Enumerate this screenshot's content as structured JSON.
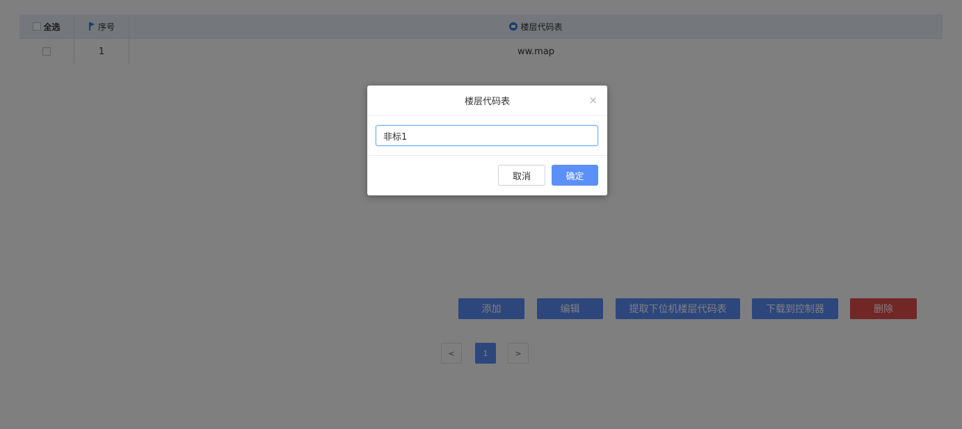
{
  "table": {
    "headers": {
      "select_all": "全选",
      "index": "序号",
      "floor_code_table": "楼层代码表"
    },
    "rows": [
      {
        "index": "1",
        "floor_code_table": "ww.map"
      }
    ]
  },
  "actions": {
    "add": "添加",
    "edit": "编辑",
    "fetch": "提取下位机楼层代码表",
    "download": "下载到控制器",
    "delete": "删除"
  },
  "pagination": {
    "prev": "<",
    "current": "1",
    "next": ">"
  },
  "dialog": {
    "title": "楼层代码表",
    "close": "×",
    "input_value": "非标1",
    "cancel": "取消",
    "confirm": "确定"
  },
  "icons": {
    "index_header": "flag-icon",
    "floor_code_header": "database-icon",
    "dialog_close": "close-icon"
  },
  "colors": {
    "primary": "#5b8ff9",
    "danger": "#e74c4c",
    "header_bg": "#e9eef6"
  }
}
